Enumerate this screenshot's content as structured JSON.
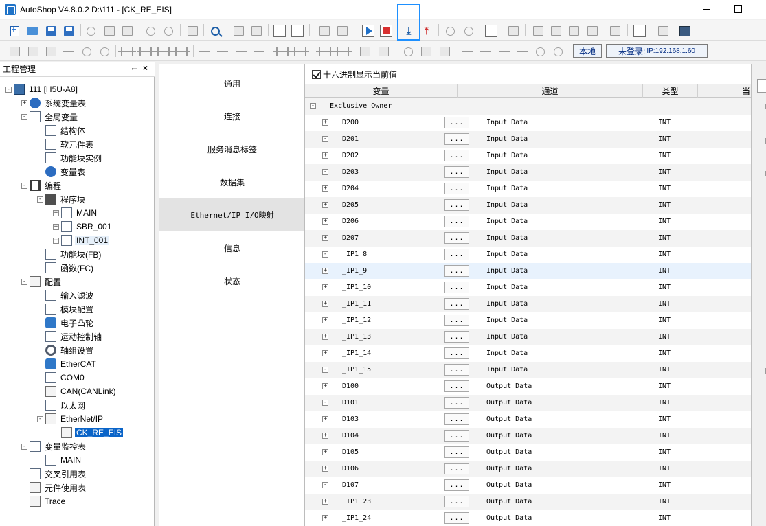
{
  "window": {
    "title": "AutoShop V4.8.0.2  D:\\111 - [CK_RE_EIS]"
  },
  "toolbar": {
    "status_local": "本地",
    "status_login": "未登录:",
    "status_ip": "IP:192.168.1.60"
  },
  "project_panel": {
    "title": "工程管理",
    "pin_glyph": "ᚘ",
    "close_glyph": "×",
    "tree": [
      {
        "label": "111 [H5U-A8]",
        "level": 0,
        "expander": "minus",
        "icon": "pc-icon"
      },
      {
        "label": "系统变量表",
        "level": 1,
        "expander": "plus",
        "icon": "globe-icon"
      },
      {
        "label": "全局变量",
        "level": 1,
        "expander": "minus",
        "icon": "document-icon"
      },
      {
        "label": "结构体",
        "level": 2,
        "expander": "",
        "icon": "struct-icon"
      },
      {
        "label": "软元件表",
        "level": 2,
        "expander": "",
        "icon": "comment-icon"
      },
      {
        "label": "功能块实例",
        "level": 2,
        "expander": "",
        "icon": "cube-icon"
      },
      {
        "label": "变量表",
        "level": 2,
        "expander": "",
        "icon": "globe-icon"
      },
      {
        "label": "编程",
        "level": 1,
        "expander": "minus",
        "icon": "ladder-icon"
      },
      {
        "label": "程序块",
        "level": 2,
        "expander": "minus",
        "icon": "grid-icon"
      },
      {
        "label": "MAIN",
        "level": 3,
        "expander": "plus",
        "icon": "program-icon"
      },
      {
        "label": "SBR_001",
        "level": 3,
        "expander": "plus",
        "icon": "program-icon"
      },
      {
        "label": "INT_001",
        "level": 3,
        "expander": "plus",
        "icon": "program-icon",
        "state": "highlight"
      },
      {
        "label": "功能块(FB)",
        "level": 2,
        "expander": "",
        "icon": "list-icon"
      },
      {
        "label": "函数(FC)",
        "level": 2,
        "expander": "",
        "icon": "list-icon"
      },
      {
        "label": "配置",
        "level": 1,
        "expander": "minus",
        "icon": "config-icon"
      },
      {
        "label": "输入滤波",
        "level": 2,
        "expander": "",
        "icon": "wave-icon"
      },
      {
        "label": "模块配置",
        "level": 2,
        "expander": "",
        "icon": "module-icon"
      },
      {
        "label": "电子凸轮",
        "level": 2,
        "expander": "",
        "icon": "cam-icon"
      },
      {
        "label": "运动控制轴",
        "level": 2,
        "expander": "",
        "icon": "axis-icon"
      },
      {
        "label": "轴组设置",
        "level": 2,
        "expander": "",
        "icon": "gear-icon"
      },
      {
        "label": "EtherCAT",
        "level": 2,
        "expander": "",
        "icon": "ethercat-icon"
      },
      {
        "label": "COM0",
        "level": 2,
        "expander": "",
        "icon": "serial-port-icon"
      },
      {
        "label": "CAN(CANLink)",
        "level": 2,
        "expander": "",
        "icon": "network-icon"
      },
      {
        "label": "以太网",
        "level": 2,
        "expander": "",
        "icon": "ethernet-icon"
      },
      {
        "label": "EtherNet/IP",
        "level": 2,
        "expander": "minus",
        "icon": "config-icon"
      },
      {
        "label": "CK_RE_EIS",
        "level": 3,
        "expander": "",
        "icon": "device-icon",
        "state": "selected"
      },
      {
        "label": "变量监控表",
        "level": 1,
        "expander": "minus",
        "icon": "monitor-icon"
      },
      {
        "label": "MAIN",
        "level": 2,
        "expander": "",
        "icon": "table-icon"
      },
      {
        "label": "交叉引用表",
        "level": 1,
        "expander": "",
        "icon": "cross-reference-icon"
      },
      {
        "label": "元件使用表",
        "level": 1,
        "expander": "",
        "icon": "database-icon"
      },
      {
        "label": "Trace",
        "level": 1,
        "expander": "",
        "icon": "trace-icon"
      }
    ]
  },
  "nav": {
    "items": [
      {
        "label": "通用",
        "mono": false
      },
      {
        "label": "连接",
        "mono": false
      },
      {
        "label": "服务消息标签",
        "mono": false
      },
      {
        "label": "数据集",
        "mono": false
      },
      {
        "label": "Ethernet/IP I/O映射",
        "mono": true,
        "active": true
      },
      {
        "label": "信息",
        "mono": false
      },
      {
        "label": "状态",
        "mono": false
      }
    ]
  },
  "grid": {
    "hex_label": "十六进制显示当前值",
    "hex_checked": true,
    "columns": [
      "变量",
      "通道",
      "类型",
      "当"
    ],
    "group_label": "Exclusive Owner",
    "dots_label": "...",
    "rows": [
      {
        "var": "D200",
        "channel": "Input Data",
        "type": "INT",
        "expander": "plus"
      },
      {
        "var": "D201",
        "channel": "Input Data",
        "type": "INT",
        "expander": "minus"
      },
      {
        "var": "D202",
        "channel": "Input Data",
        "type": "INT",
        "expander": "plus"
      },
      {
        "var": "D203",
        "channel": "Input Data",
        "type": "INT",
        "expander": "minus"
      },
      {
        "var": "D204",
        "channel": "Input Data",
        "type": "INT",
        "expander": "plus"
      },
      {
        "var": "D205",
        "channel": "Input Data",
        "type": "INT",
        "expander": "plus"
      },
      {
        "var": "D206",
        "channel": "Input Data",
        "type": "INT",
        "expander": "plus"
      },
      {
        "var": "D207",
        "channel": "Input Data",
        "type": "INT",
        "expander": "plus"
      },
      {
        "var": "_IP1_8",
        "channel": "Input Data",
        "type": "INT",
        "expander": "minus"
      },
      {
        "var": "_IP1_9",
        "channel": "Input Data",
        "type": "INT",
        "expander": "plus"
      },
      {
        "var": "_IP1_10",
        "channel": "Input Data",
        "type": "INT",
        "expander": "plus"
      },
      {
        "var": "_IP1_11",
        "channel": "Input Data",
        "type": "INT",
        "expander": "plus"
      },
      {
        "var": "_IP1_12",
        "channel": "Input Data",
        "type": "INT",
        "expander": "plus"
      },
      {
        "var": "_IP1_13",
        "channel": "Input Data",
        "type": "INT",
        "expander": "plus"
      },
      {
        "var": "_IP1_14",
        "channel": "Input Data",
        "type": "INT",
        "expander": "plus"
      },
      {
        "var": "_IP1_15",
        "channel": "Input Data",
        "type": "INT",
        "expander": "minus"
      },
      {
        "var": "D100",
        "channel": "Output Data",
        "type": "INT",
        "expander": "plus"
      },
      {
        "var": "D101",
        "channel": "Output Data",
        "type": "INT",
        "expander": "minus"
      },
      {
        "var": "D103",
        "channel": "Output Data",
        "type": "INT",
        "expander": "plus"
      },
      {
        "var": "D104",
        "channel": "Output Data",
        "type": "INT",
        "expander": "plus"
      },
      {
        "var": "D105",
        "channel": "Output Data",
        "type": "INT",
        "expander": "plus"
      },
      {
        "var": "D106",
        "channel": "Output Data",
        "type": "INT",
        "expander": "plus"
      },
      {
        "var": "D107",
        "channel": "Output Data",
        "type": "INT",
        "expander": "minus"
      },
      {
        "var": "_IP1_23",
        "channel": "Output Data",
        "type": "INT",
        "expander": "plus"
      },
      {
        "var": "_IP1_24",
        "channel": "Output Data",
        "type": "INT",
        "expander": "plus"
      }
    ]
  },
  "colors": {
    "selected": "#0a64c8",
    "highlight_border": "#1e90ff",
    "accent_blue": "#1f70c8",
    "stop_red": "#d83030"
  }
}
